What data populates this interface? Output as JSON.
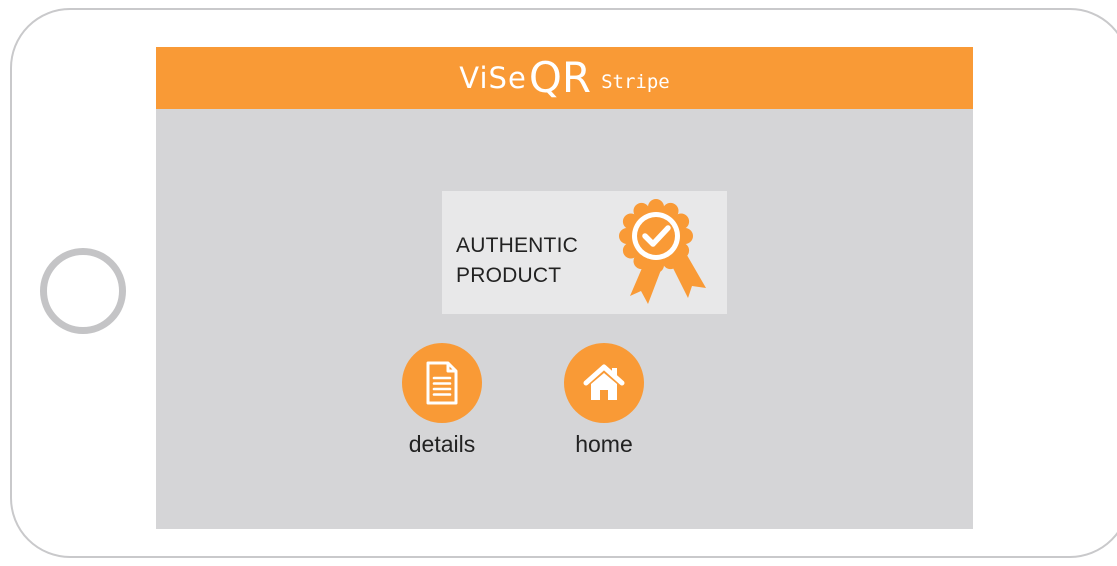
{
  "app": {
    "logo": {
      "part1": "ViSe",
      "part2": "QR",
      "part3": "Stripe"
    }
  },
  "result": {
    "line1": "AUTHENTIC",
    "line2": "PRODUCT",
    "badge_icon": "award-ribbon-check-icon"
  },
  "actions": [
    {
      "label": "details",
      "icon": "document-icon"
    },
    {
      "label": "home",
      "icon": "house-icon"
    }
  ],
  "colors": {
    "accent": "#f99a36",
    "screen_background": "#d5d5d7",
    "card_background": "#e8e8e9",
    "text": "#222222"
  }
}
